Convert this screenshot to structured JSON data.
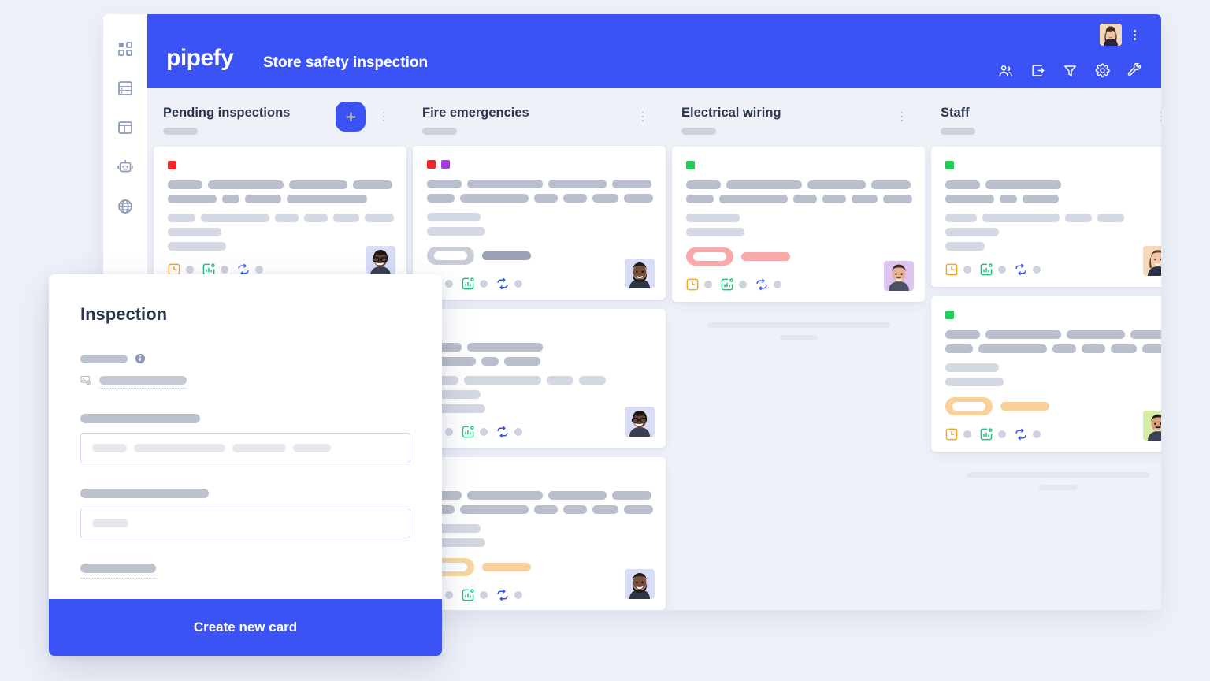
{
  "brand": {
    "logo_text": "pipefy",
    "accent": "#3b53f5"
  },
  "header": {
    "pipe_title": "Store safety inspection",
    "avatar_name": "user-avatar",
    "tools": [
      {
        "name": "members-icon",
        "label": "Members"
      },
      {
        "name": "inbox-import-icon",
        "label": "Inbox"
      },
      {
        "name": "filter-icon",
        "label": "Filter"
      },
      {
        "name": "settings-gear-icon",
        "label": "Settings"
      },
      {
        "name": "wrench-tools-icon",
        "label": "Tools"
      }
    ],
    "kebab_label": "More options"
  },
  "sidebar": {
    "items": [
      {
        "name": "dashboard-grid-icon",
        "label": "Dashboard"
      },
      {
        "name": "database-icon",
        "label": "Database"
      },
      {
        "name": "layout-panel-icon",
        "label": "Portals"
      },
      {
        "name": "robot-automation-icon",
        "label": "Automations"
      },
      {
        "name": "globe-icon",
        "label": "Public"
      }
    ]
  },
  "board": {
    "add_card_label": "+",
    "columns": [
      {
        "title": "Pending inspections",
        "has_add_button": true,
        "has_footer": false,
        "cards": [
          {
            "labels": [
              "#f0262a"
            ],
            "tag_pill": null,
            "tag_bar": null,
            "avatar_bg": "#d8dcf5",
            "lines": [
              [
                44,
                96,
                74,
                50
              ],
              [
                62,
                22,
                46,
                102
              ],
              [
                40,
                98,
                34,
                34,
                38,
                42
              ],
              [
                68
              ],
              [
                74
              ]
            ]
          }
        ]
      },
      {
        "title": "Fire emergencies",
        "has_add_button": false,
        "has_footer": false,
        "cards": [
          {
            "labels": [
              "#f0262a",
              "#a23ce0"
            ],
            "tag_pill": "#c8cdd8",
            "tag_bar": "#9aa2b4",
            "avatar_bg": "#d8dcf5",
            "lines": [
              [
                44,
                96,
                74,
                50
              ],
              [
                40,
                98,
                34,
                34,
                38,
                42
              ],
              [
                68
              ],
              [
                74
              ]
            ]
          },
          {
            "labels": [],
            "tag_pill": null,
            "tag_bar": null,
            "avatar_bg": "#d8dcf5",
            "lines": [
              [
                44,
                96
              ],
              [
                62,
                22,
                46
              ],
              [
                40,
                98,
                34,
                34
              ],
              [
                68
              ],
              [
                74
              ]
            ]
          },
          {
            "labels": [],
            "tag_pill": "#f7d6a0",
            "tag_bar": "#f7d0a0",
            "avatar_bg": "#d8dcf5",
            "lines": [
              [
                44,
                96,
                74,
                50
              ],
              [
                40,
                98,
                34,
                34,
                38,
                42
              ],
              [
                68
              ],
              [
                74
              ]
            ]
          }
        ]
      },
      {
        "title": "Electrical wiring",
        "has_add_button": false,
        "has_footer": true,
        "cards": [
          {
            "labels": [
              "#27ca58"
            ],
            "tag_pill": "#f9a9a9",
            "tag_bar": "#f9a9a9",
            "avatar_bg": "#ddc4f0",
            "lines": [
              [
                44,
                96,
                74,
                50
              ],
              [
                40,
                98,
                34,
                34,
                38,
                42
              ],
              [
                68
              ],
              [
                74
              ]
            ]
          }
        ]
      },
      {
        "title": "Staff",
        "has_add_button": false,
        "has_footer": true,
        "cards": [
          {
            "labels": [
              "#27ca58"
            ],
            "tag_pill": null,
            "tag_bar": null,
            "avatar_bg": "#f5d9bb",
            "lines": [
              [
                44,
                96
              ],
              [
                62,
                22,
                46
              ],
              [
                40,
                98,
                34,
                34
              ],
              [
                68
              ],
              [
                50
              ]
            ]
          },
          {
            "labels": [
              "#27ca58"
            ],
            "tag_pill": "#f9cf9a",
            "tag_bar": "#f9cf9a",
            "avatar_bg": "#d7eda3",
            "lines": [
              [
                44,
                96,
                74,
                50
              ],
              [
                40,
                98,
                34,
                34,
                38,
                42
              ],
              [
                68
              ],
              [
                74
              ]
            ]
          }
        ]
      }
    ],
    "card_foot_icons": [
      {
        "name": "clock-due-date-icon",
        "color": "#f5a623"
      },
      {
        "name": "checklist-progress-icon",
        "color": "#1fc47a"
      },
      {
        "name": "connection-repeat-icon",
        "color": "#2f55f0"
      }
    ]
  },
  "modal": {
    "title": "Inspection",
    "create_button_label": "Create new card",
    "info_icon_name": "info-circle-icon",
    "attachment_icon_name": "image-card-icon",
    "fields": [
      {
        "type": "readonly-value",
        "label_width": 60,
        "value_width": 111
      },
      {
        "type": "text-input",
        "label_width": 152,
        "placeholders": [
          44,
          116,
          68,
          48
        ]
      },
      {
        "type": "text-input",
        "label_width": 163,
        "placeholders": [
          46
        ]
      },
      {
        "type": "readonly-value",
        "label_width": 96,
        "value_width": 0
      }
    ]
  }
}
